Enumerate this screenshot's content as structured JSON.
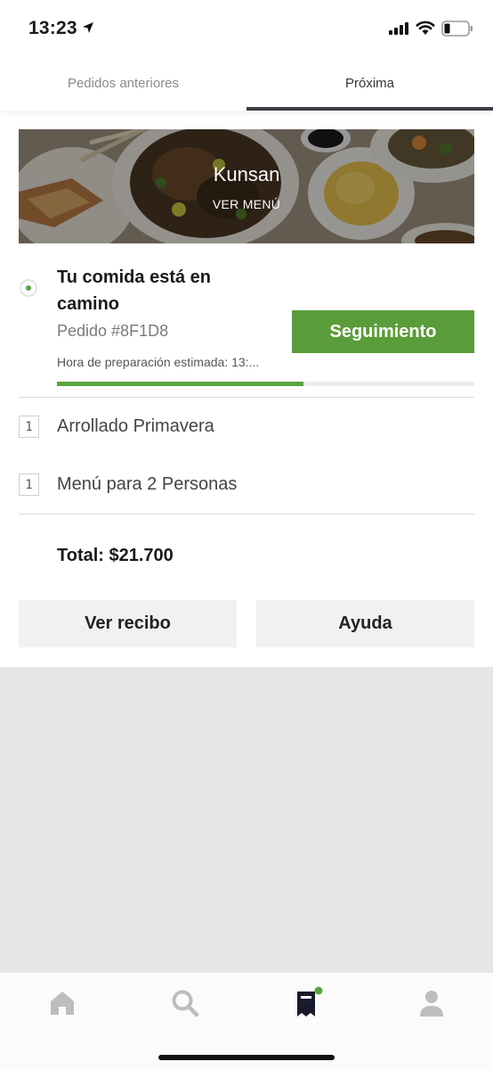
{
  "status_bar": {
    "time": "13:23",
    "icons": [
      "location-arrow-icon",
      "signal-icon",
      "wifi-icon",
      "battery-icon"
    ]
  },
  "tabs": [
    {
      "label": "Pedidos anteriores",
      "active": false
    },
    {
      "label": "Próxima",
      "active": true
    }
  ],
  "restaurant": {
    "name": "Kunsan",
    "menu_link": "VER MENÚ"
  },
  "order": {
    "status_title": "Tu comida está en camino",
    "order_id": "Pedido #8F1D8",
    "track_button": "Seguimiento",
    "prep_time": "Hora de preparación estimada: 13:...",
    "progress": 0.59,
    "items": [
      {
        "qty": "1",
        "name": "Arrollado Primavera"
      },
      {
        "qty": "1",
        "name": "Menú para 2 Personas"
      }
    ],
    "total": "Total: $21.700"
  },
  "actions": {
    "receipt": "Ver recibo",
    "help": "Ayuda"
  },
  "bottom_nav": [
    {
      "icon": "home-icon",
      "active": false
    },
    {
      "icon": "search-icon",
      "active": false
    },
    {
      "icon": "orders-icon",
      "active": true,
      "badge": true
    },
    {
      "icon": "account-icon",
      "active": false
    }
  ],
  "colors": {
    "accent_green": "#5a9c3a",
    "progress_green": "#5aa441",
    "tab_underline": "#3d3d46",
    "gray_area": "#e6e6e8"
  }
}
